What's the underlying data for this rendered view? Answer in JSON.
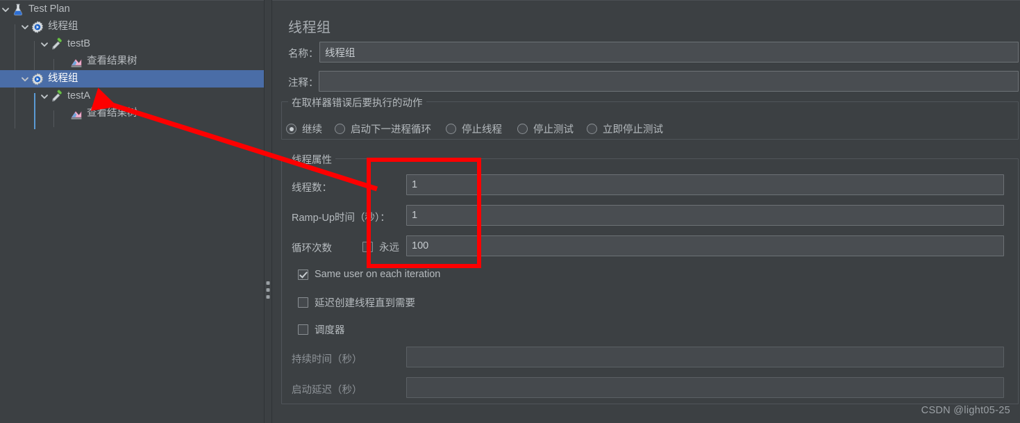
{
  "tree": {
    "name": "test-plan-tree",
    "nodes": [
      {
        "label": "Test Plan",
        "icon": "flask-icon",
        "depth": 0,
        "expanded": true,
        "selected": false
      },
      {
        "label": "线程组",
        "icon": "gear-icon",
        "depth": 1,
        "expanded": true,
        "selected": false
      },
      {
        "label": "testB",
        "icon": "pipette-icon",
        "depth": 2,
        "expanded": true,
        "selected": false
      },
      {
        "label": "查看结果树",
        "icon": "results-tree-icon",
        "depth": 3,
        "expanded": false,
        "selected": false
      },
      {
        "label": "线程组",
        "icon": "gear-icon",
        "depth": 1,
        "expanded": true,
        "selected": true
      },
      {
        "label": "testA",
        "icon": "pipette-icon",
        "depth": 2,
        "expanded": true,
        "selected": false
      },
      {
        "label": "查看结果树",
        "icon": "results-tree-icon",
        "depth": 3,
        "expanded": false,
        "selected": false
      }
    ]
  },
  "panel": {
    "title": "线程组",
    "name_label": "名称：",
    "name_value": "线程组",
    "comment_label": "注释：",
    "comment_value": "",
    "comment_placeholder": ""
  },
  "on_sampler_error": {
    "group_title": "在取样器错误后要执行的动作",
    "options": [
      {
        "label": "继续",
        "checked": true
      },
      {
        "label": "启动下一进程循环",
        "checked": false
      },
      {
        "label": "停止线程",
        "checked": false
      },
      {
        "label": "停止测试",
        "checked": false
      },
      {
        "label": "立即停止测试",
        "checked": false
      }
    ]
  },
  "thread_properties": {
    "group_title": "线程属性",
    "threads_label": "线程数：",
    "threads_value": "1",
    "rampup_label": "Ramp-Up时间（秒）：",
    "rampup_value": "1",
    "loops_label": "循环次数",
    "forever_label": "永远",
    "forever_checked": false,
    "loops_value": "100",
    "checkboxes": [
      {
        "label": "Same user on each iteration",
        "checked": true
      },
      {
        "label": "延迟创建线程直到需要",
        "checked": false
      },
      {
        "label": "调度器",
        "checked": false
      }
    ],
    "duration_label": "持续时间（秒）",
    "duration_value": "",
    "startup_delay_label": "启动延迟（秒）",
    "startup_delay_value": ""
  },
  "annotations": {
    "highlight_color": "#fe0000",
    "arrow_color": "#fe0000",
    "arrow_from": "线程数输入框",
    "arrow_to": "testA"
  },
  "watermark": {
    "text": "CSDN @light05-25"
  },
  "colors": {
    "background": "#3c4043",
    "selection": "#4a6da7",
    "input_bg": "#494d51",
    "text": "#b6bbbf",
    "accent": "#5b9bd5"
  }
}
